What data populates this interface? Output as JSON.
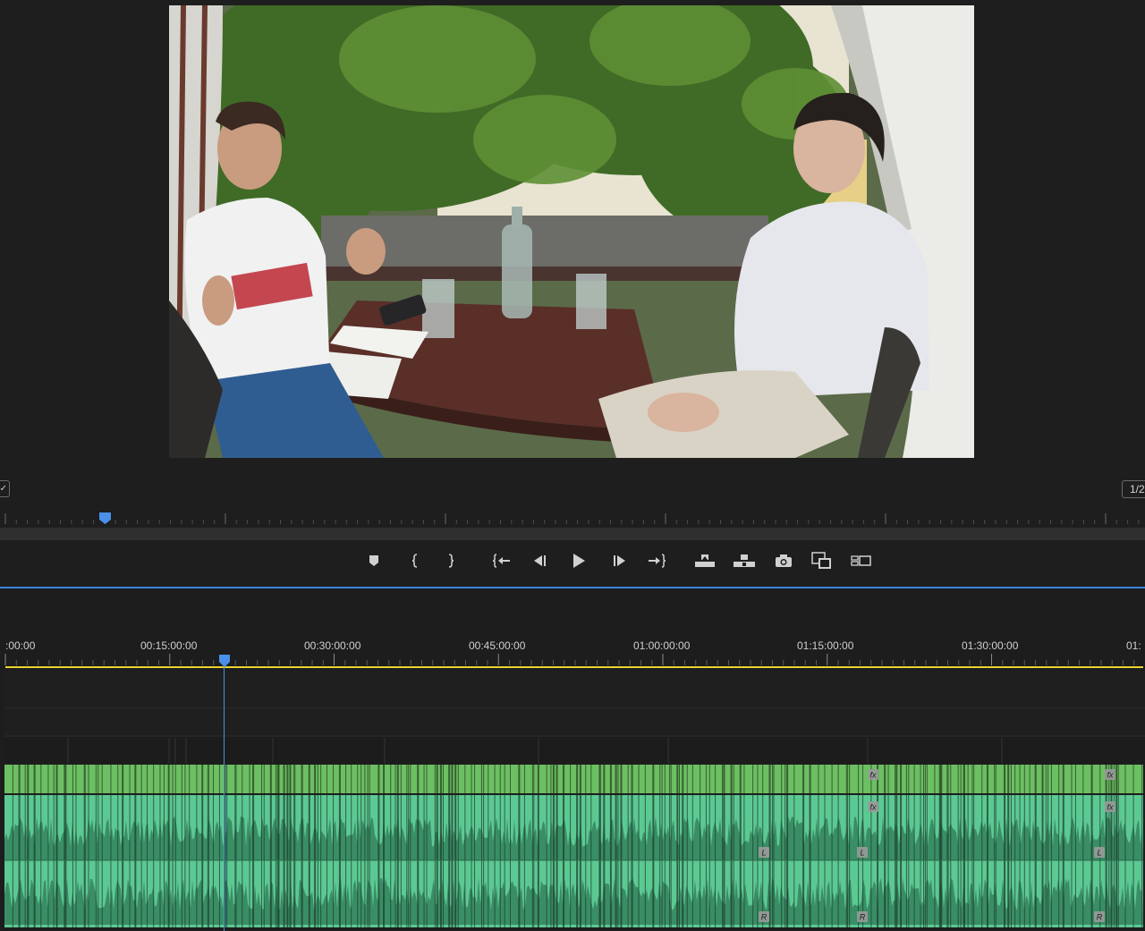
{
  "monitor": {
    "fit_value": "✓",
    "resolution_value": "1/2",
    "video": {
      "description_icon": "video-frame-icon"
    }
  },
  "transport": {
    "buttons": [
      {
        "name": "add-marker-button",
        "icon": "marker-icon"
      },
      {
        "name": "mark-in-button",
        "icon": "mark-in-icon"
      },
      {
        "name": "mark-out-button",
        "icon": "mark-out-icon"
      },
      {
        "name": "go-to-in-button",
        "icon": "go-to-in-icon"
      },
      {
        "name": "step-back-button",
        "icon": "step-back-icon"
      },
      {
        "name": "play-button",
        "icon": "play-icon"
      },
      {
        "name": "step-forward-button",
        "icon": "step-forward-icon"
      },
      {
        "name": "go-to-out-button",
        "icon": "go-to-out-icon"
      },
      {
        "name": "lift-button",
        "icon": "lift-icon"
      },
      {
        "name": "extract-button",
        "icon": "extract-icon"
      },
      {
        "name": "export-frame-button",
        "icon": "camera-icon"
      },
      {
        "name": "comparison-view-button",
        "icon": "comparison-icon"
      },
      {
        "name": "multicam-button",
        "icon": "multicam-icon"
      }
    ]
  },
  "timeline": {
    "timecodes": [
      ":00:00",
      "00:15:00:00",
      "00:30:00:00",
      "00:45:00:00",
      "01:00:00:00",
      "01:15:00:00",
      "01:30:00:00",
      "01:"
    ],
    "playhead_timecode_fraction": 0.0,
    "fx_badge": "fx",
    "channel_left": "L",
    "channel_right": "R",
    "colors": {
      "video_clip": "#6cbf62",
      "audio_clip": "#5cc993",
      "audio_wave": "#2e7a55",
      "work_area": "#e8d430",
      "playhead": "#4a90e8"
    }
  }
}
